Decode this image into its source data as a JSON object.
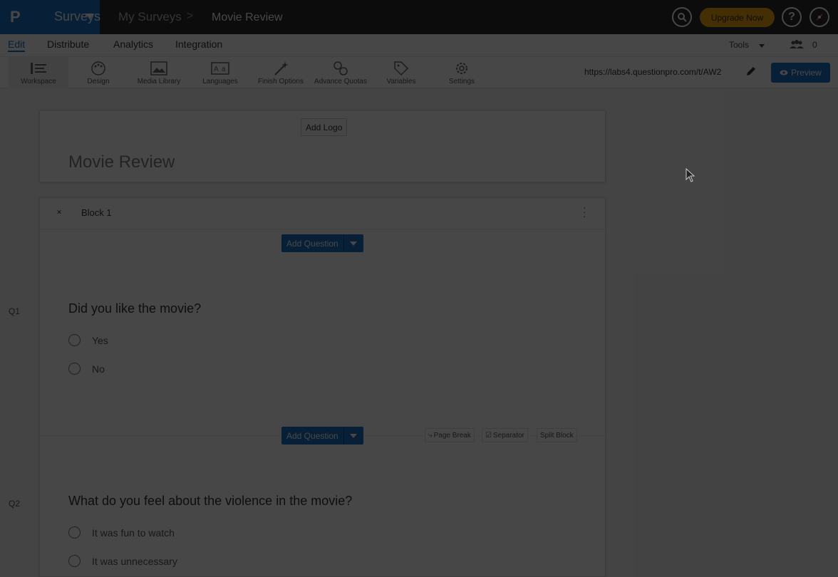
{
  "topbar": {
    "brand_logo": "P",
    "brand_name": "Surveys",
    "breadcrumb_parent": "My Surveys",
    "breadcrumb_separator": ">",
    "breadcrumb_current": "Movie Review",
    "upgrade_label": "Upgrade Now",
    "help_label": "?",
    "icons": [
      "search-icon",
      "help-icon",
      "avatar-icon"
    ]
  },
  "subnav": {
    "tabs": [
      "Edit",
      "Distribute",
      "Analytics",
      "Integration"
    ],
    "active_tab": "Edit",
    "tools_label": "Tools",
    "collaborators_count": "0"
  },
  "toolbar": {
    "tools": [
      {
        "label": "Workspace",
        "icon": "workspace-icon"
      },
      {
        "label": "Design",
        "icon": "palette-icon"
      },
      {
        "label": "Media Library",
        "icon": "image-icon"
      },
      {
        "label": "Languages",
        "icon": "translate-icon"
      },
      {
        "label": "Finish Options",
        "icon": "wand-icon"
      },
      {
        "label": "Advance Quotas",
        "icon": "quota-icon"
      },
      {
        "label": "Variables",
        "icon": "tag-icon"
      },
      {
        "label": "Settings",
        "icon": "gear-icon"
      }
    ],
    "survey_url": "https://labs4.questionpro.com/t/AW2",
    "preview_label": "Preview"
  },
  "survey": {
    "add_logo_label": "Add Logo",
    "title": "Movie Review",
    "block": {
      "title": "Block 1",
      "add_question_label": "Add Question",
      "page_break_label": "Page Break",
      "separator_label": "Separator",
      "split_block_label": "Split Block",
      "questions": [
        {
          "number": "Q1",
          "text": "Did you like the movie?",
          "options": [
            "Yes",
            "No"
          ]
        },
        {
          "number": "Q2",
          "text": "What do you feel about the violence in the movie?",
          "options": [
            "It was fun to watch",
            "It was unnecessary"
          ]
        }
      ]
    }
  },
  "colors": {
    "accent": "#1a73c8",
    "upgrade": "#f2a40f",
    "topbar": "#2b2b2b"
  }
}
